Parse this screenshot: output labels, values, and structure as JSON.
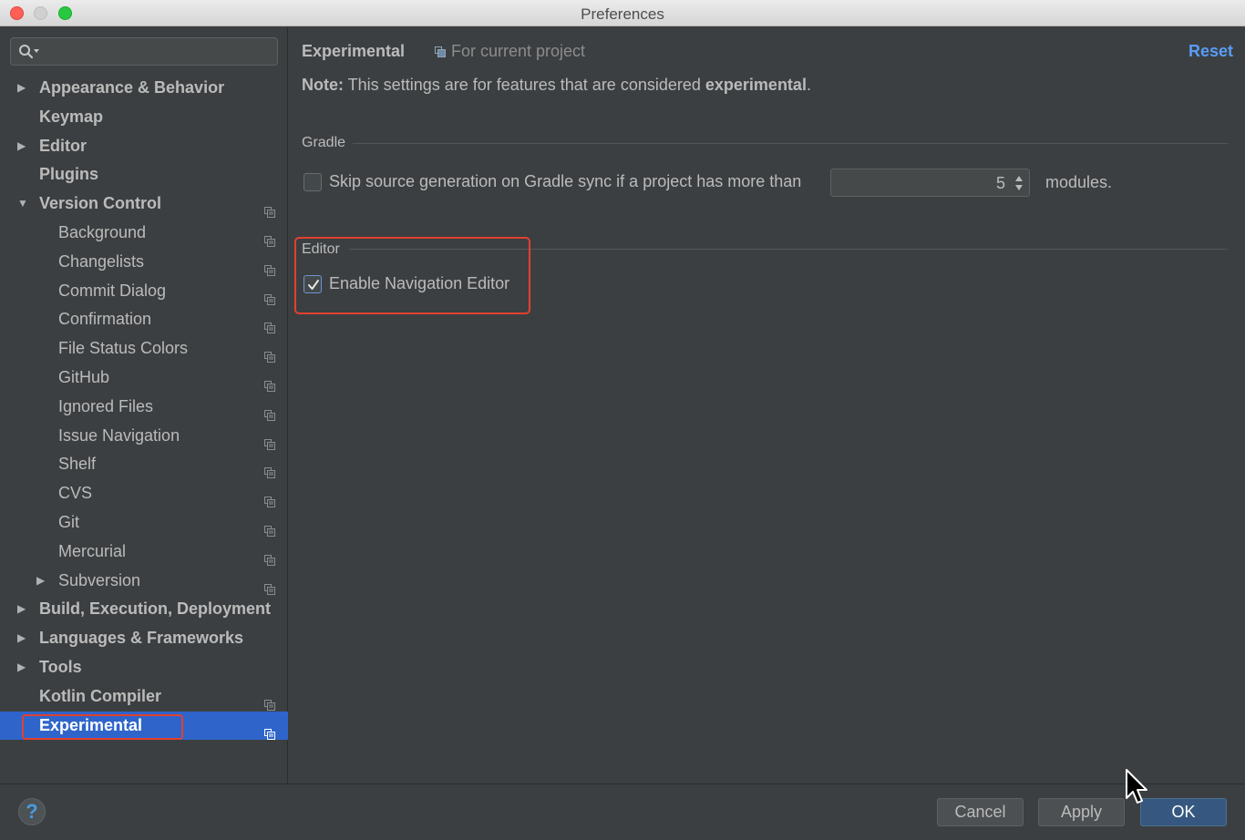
{
  "window": {
    "title": "Preferences"
  },
  "sidebar": {
    "search_placeholder": "",
    "items": [
      {
        "label": "Appearance & Behavior",
        "level": 0,
        "expander": "collapsed",
        "scope_icon": false
      },
      {
        "label": "Keymap",
        "level": 0,
        "expander": "none",
        "scope_icon": false
      },
      {
        "label": "Editor",
        "level": 0,
        "expander": "collapsed",
        "scope_icon": false
      },
      {
        "label": "Plugins",
        "level": 0,
        "expander": "none",
        "scope_icon": false
      },
      {
        "label": "Version Control",
        "level": 0,
        "expander": "expanded",
        "scope_icon": true
      },
      {
        "label": "Background",
        "level": 1,
        "expander": "none",
        "scope_icon": true
      },
      {
        "label": "Changelists",
        "level": 1,
        "expander": "none",
        "scope_icon": true
      },
      {
        "label": "Commit Dialog",
        "level": 1,
        "expander": "none",
        "scope_icon": true
      },
      {
        "label": "Confirmation",
        "level": 1,
        "expander": "none",
        "scope_icon": true
      },
      {
        "label": "File Status Colors",
        "level": 1,
        "expander": "none",
        "scope_icon": true
      },
      {
        "label": "GitHub",
        "level": 1,
        "expander": "none",
        "scope_icon": true
      },
      {
        "label": "Ignored Files",
        "level": 1,
        "expander": "none",
        "scope_icon": true
      },
      {
        "label": "Issue Navigation",
        "level": 1,
        "expander": "none",
        "scope_icon": true
      },
      {
        "label": "Shelf",
        "level": 1,
        "expander": "none",
        "scope_icon": true
      },
      {
        "label": "CVS",
        "level": 1,
        "expander": "none",
        "scope_icon": true
      },
      {
        "label": "Git",
        "level": 1,
        "expander": "none",
        "scope_icon": true
      },
      {
        "label": "Mercurial",
        "level": 1,
        "expander": "none",
        "scope_icon": true
      },
      {
        "label": "Subversion",
        "level": 1,
        "expander": "collapsed",
        "scope_icon": true
      },
      {
        "label": "Build, Execution, Deployment",
        "level": 0,
        "expander": "collapsed",
        "scope_icon": false
      },
      {
        "label": "Languages & Frameworks",
        "level": 0,
        "expander": "collapsed",
        "scope_icon": false
      },
      {
        "label": "Tools",
        "level": 0,
        "expander": "collapsed",
        "scope_icon": false
      },
      {
        "label": "Kotlin Compiler",
        "level": 0,
        "expander": "none",
        "scope_icon": true
      },
      {
        "label": "Experimental",
        "level": 0,
        "expander": "none",
        "scope_icon": true,
        "selected": true
      }
    ]
  },
  "main": {
    "title": "Experimental",
    "scope_label": "For current project",
    "reset_label": "Reset",
    "note_prefix": "Note:",
    "note_text": " This settings are for features that are considered ",
    "note_bold": "experimental",
    "note_suffix": ".",
    "gradle": {
      "title": "Gradle",
      "skip_label": "Skip source generation on Gradle sync if a project has more than",
      "skip_checked": false,
      "modules_value": "5",
      "modules_suffix": "modules."
    },
    "editor": {
      "title": "Editor",
      "nav_label": "Enable Navigation Editor",
      "nav_checked": true
    }
  },
  "footer": {
    "help_label": "?",
    "cancel_label": "Cancel",
    "apply_label": "Apply",
    "ok_label": "OK"
  },
  "colors": {
    "background": "#3c3f41",
    "selection": "#2f65ca",
    "link": "#589df6",
    "highlight": "#e0412f",
    "ok_button": "#365880"
  }
}
